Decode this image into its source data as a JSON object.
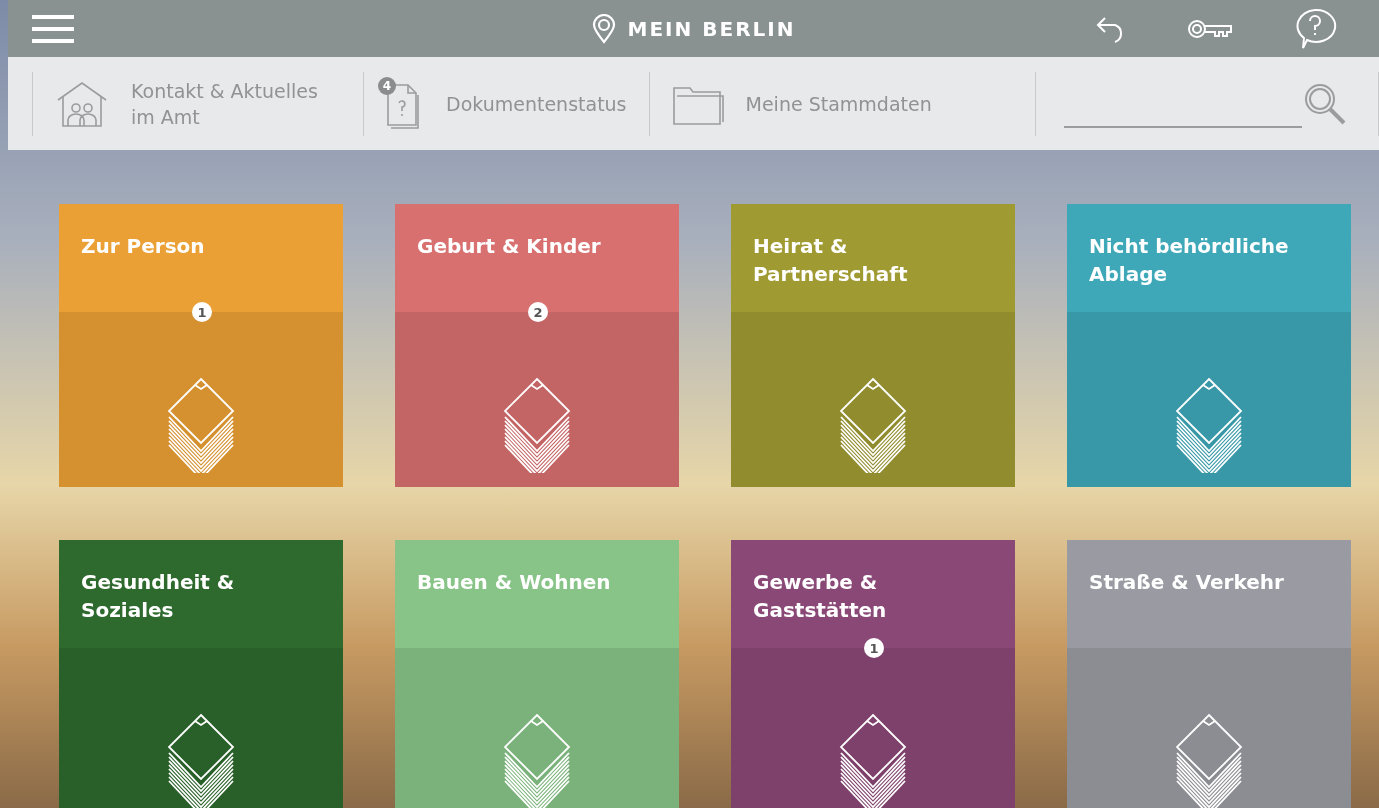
{
  "header": {
    "title": "MEIN BERLIN"
  },
  "toolbar": {
    "items": [
      {
        "kind": "contact",
        "label": "Kontakt & Aktuelles im Amt"
      },
      {
        "kind": "documents",
        "label": "Dokumentenstatus",
        "badge": "4"
      },
      {
        "kind": "folder",
        "label": "Meine Stammdaten"
      }
    ]
  },
  "tiles": [
    {
      "title": "Zur Person",
      "color": "#eba035",
      "badge": "1"
    },
    {
      "title": "Geburt & Kinder",
      "color": "#d87070",
      "badge": "2"
    },
    {
      "title": "Heirat & Partnerschaft",
      "color": "#a09a32"
    },
    {
      "title": "Nicht behördliche Ablage",
      "color": "#3ea8b8"
    },
    {
      "title": "Gesundheit & Soziales",
      "color": "#2e6a2e"
    },
    {
      "title": "Bauen & Wohnen",
      "color": "#88c488"
    },
    {
      "title": "Gewerbe & Gaststätten",
      "color": "#8a4876",
      "badge": "1"
    },
    {
      "title": "Straße & Verkehr",
      "color": "#9a9aa2"
    }
  ]
}
